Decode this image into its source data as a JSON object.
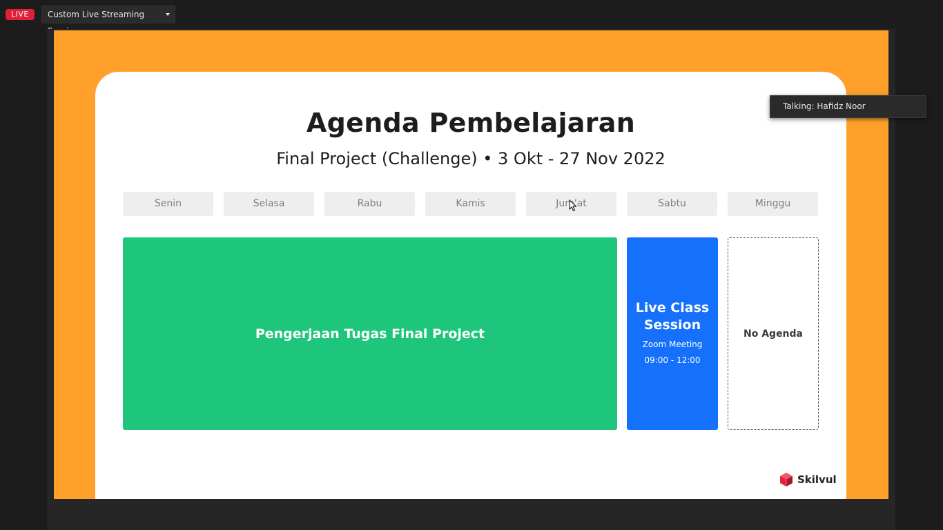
{
  "topbar": {
    "live_label": "LIVE",
    "stream_service": "Custom Live Streaming Service"
  },
  "talking_indicator": "Talking: Hafidz Noor",
  "slide": {
    "title": "Agenda Pembelajaran",
    "subtitle": "Final Project (Challenge) • 3 Okt - 27 Nov 2022",
    "days": [
      "Senin",
      "Selasa",
      "Rabu",
      "Kamis",
      "Jum'at",
      "Sabtu",
      "Minggu"
    ],
    "blocks": {
      "project": {
        "title": "Pengerjaan Tugas Final Project"
      },
      "live_class": {
        "title": "Live Class Session",
        "platform": "Zoom Meeting",
        "time": "09:00 - 12:00"
      },
      "sunday": {
        "title": "No Agenda"
      }
    },
    "logo_text": "Skilvul"
  },
  "colors": {
    "live_red": "#e0203b",
    "slide_frame_orange": "#ffa02b",
    "project_green": "#1ec67b",
    "live_class_blue": "#1570fb",
    "logo_red": "#e0243b"
  },
  "icons": {
    "dropdown": "chevron-down-icon",
    "logo": "skilvul-cube-icon",
    "pointer": "mouse-cursor-icon"
  }
}
